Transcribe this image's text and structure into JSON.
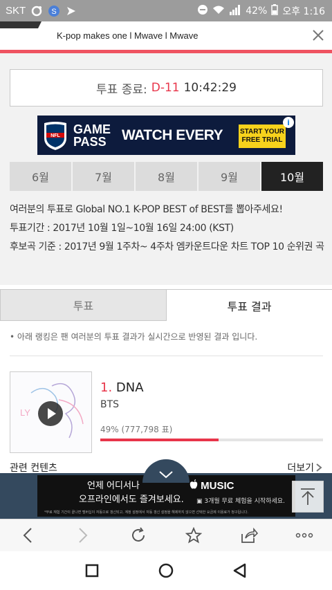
{
  "status_bar": {
    "carrier": "SKT",
    "battery": "42%",
    "time": "오후 1:16"
  },
  "browser": {
    "page_title": "K-pop makes one l Mwave l Mwave"
  },
  "vote": {
    "label": "투표 종료:",
    "dday": "D-11",
    "remaining": "10:42:29"
  },
  "ad_top": {
    "brand_line1": "GAME",
    "brand_line2": "PASS",
    "headline": "WATCH EVERY",
    "cta": "START YOUR FREE TRIAL",
    "info": "i"
  },
  "month_tabs": [
    {
      "label": "6월"
    },
    {
      "label": "7월"
    },
    {
      "label": "8월"
    },
    {
      "label": "9월"
    },
    {
      "label": "10월",
      "active": true
    }
  ],
  "description": {
    "line1": "여러분의 투표로 Global NO.1 K-POP BEST of BEST를 뽑아주세요!",
    "line2": "투표기간 : 2017년 10월 1일~10월 16일 24:00 (KST)",
    "line3": "후보곡 기준 : 2017년 9월 1주차~ 4주차 엠카운트다운 차트 TOP 10 순위권 곡"
  },
  "result_tabs": {
    "vote": "투표",
    "results": "투표 결과"
  },
  "notice": "아래 랭킹은 팬 여러분의 투표 결과가 실시간으로 반영된 결과 입니다.",
  "ranking": [
    {
      "rank": "1.",
      "title": "DNA",
      "artist": "BTS",
      "percent_text": "49% (777,798 표)",
      "share": 0.53,
      "album_text": "LY"
    }
  ],
  "related": {
    "label": "관련 컨텐츠",
    "more": "더보기"
  },
  "ad_bottom": {
    "line1": "언제 어디서나",
    "line2": "오프라인에서도 즐겨보세요.",
    "brand": "MUSIC",
    "offer": "3개월 무료 체험을 시작하세요.",
    "fine_print": "*무료 체험 기간이 끝나면 멤버십이 자동으로 갱신되고, 계정 설정에서 자동 갱신 설정을 해제하지 않으면 선택한 요금제 이용료가 청구됩니다."
  },
  "colors": {
    "accent": "#e8354a",
    "active_tab": "#222222",
    "ad_navy": "#0d1b3d"
  }
}
